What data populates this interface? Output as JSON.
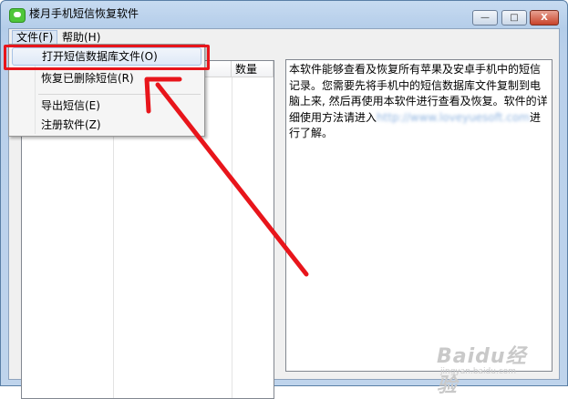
{
  "window": {
    "title": "楼月手机短信恢复软件",
    "buttons": {
      "minimize": "—",
      "maximize": "□",
      "close": "X"
    }
  },
  "menubar": {
    "file": "文件(F)",
    "help": "帮助(H)"
  },
  "file_menu": {
    "items": [
      "打开短信数据库文件(O)",
      "恢复已删除短信(R)",
      "导出短信(E)",
      "注册软件(Z)"
    ]
  },
  "list": {
    "count_header": "数量"
  },
  "info": {
    "text_before": "本软件能够查看及恢复所有苹果及安卓手机中的短信记录。您需要先将手机中的短信数据库文件复制到电脑上来, 然后再使用本软件进行查看及恢复。软件的详细使用方法请进入",
    "blurred_link": "http://www.loveyuesoft.com",
    "text_after": "进行了解。"
  },
  "watermark": {
    "main": "Baidu经验",
    "sub": "jingyan.baidu.com"
  },
  "colors": {
    "annotation_red": "#e8151b",
    "client_bg": "#f0f0f0",
    "title_gradient_top": "#c7dbf1"
  }
}
